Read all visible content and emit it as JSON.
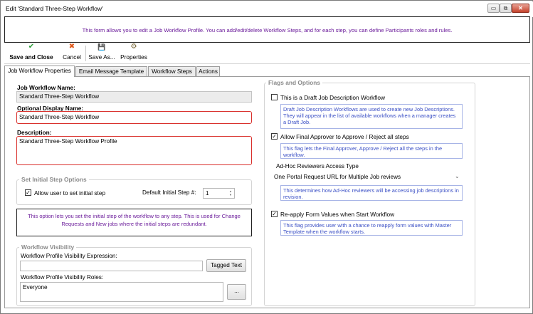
{
  "window": {
    "title": "Edit 'Standard Three-Step Workflow'",
    "min_glyph": "▭",
    "max_glyph": "⧉",
    "close_glyph": "✕"
  },
  "banner": {
    "text": "This form allows you to edit a Job Workflow Profile. You can add/edit/delete Workflow Steps, and for each step, you can define Participants roles and rules."
  },
  "toolbar": {
    "save_close_label": "Save and Close",
    "save_close_icon": "✔",
    "cancel_label": "Cancel",
    "cancel_icon": "✖",
    "save_as_label": "Save As...",
    "save_as_icon": "💾",
    "properties_label": "Properties",
    "properties_icon": "⚙"
  },
  "tabs": [
    {
      "label": "Job Workflow Properties"
    },
    {
      "label": "Email Message Template"
    },
    {
      "label": "Workflow Steps"
    },
    {
      "label": "Actions"
    }
  ],
  "left": {
    "name_label": "Job Workflow Name:",
    "name_value": "Standard Three-Step Workflow",
    "display_label": "Optional Display Name:",
    "display_value": "Standard Three-Step Workflow",
    "description_label": "Description:",
    "description_value": "Standard Three-Step Workflow Profile",
    "initial_step_group": "Set Initial Step Options",
    "allow_initial_label": "Allow user to set initial step",
    "allow_initial_checked": "✓",
    "default_step_label": "Default Initial Step #:",
    "default_step_value": "1",
    "initial_note": "This option lets you set the initial step of the workflow to any step.  This is used for Change Requests and New jobs where the initial steps are redundant.",
    "visibility_group": "Workflow Visibility",
    "visibility_expr_label": "Workflow Profile Visibility Expression:",
    "visibility_expr_value": "",
    "tagged_text_label": "Tagged Text",
    "visibility_roles_label": "Workflow Profile Visibility Roles:",
    "visibility_roles_value": "Everyone",
    "roles_browse_label": "..."
  },
  "right": {
    "group_title": "Flags and Options",
    "draft_label": "This is a Draft Job Description Workflow",
    "draft_checked": "",
    "draft_hint": "Draft Job Description Workflows are used to create new Job Descriptions. They will appear in the list of available workflows when a manager creates a Draft Job.",
    "final_approver_label": "Allow Final Approver to Approve / Reject all steps",
    "final_approver_checked": "✓",
    "final_approver_hint": "This flag lets the Final Approver, Approve / Reject all the steps in the workflow.",
    "adhoc_label": "Ad-Hoc Reviewers Access Type",
    "adhoc_value": "One Portal Request URL for Multiple Job reviews",
    "adhoc_hint": "This determines how Ad-Hoc reviewers will be accessing job descriptions in revision.",
    "reapply_label": "Re-apply Form Values when Start Workflow",
    "reapply_checked": "✓",
    "reapply_hint": "This flag provides user with a chance to reapply form values with Master Template when the workflow starts."
  },
  "colors": {
    "required_border": "#d9302c",
    "note_text": "#6a1b9a",
    "hint_text": "#3a4fc5"
  }
}
